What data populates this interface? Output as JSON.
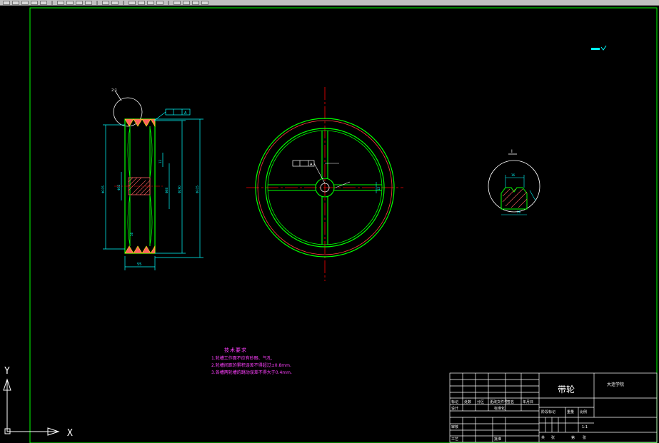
{
  "colors": {
    "background": "#000000",
    "frame": "#00ff00",
    "drawing": "#00ff00",
    "dimension": "#00ffff",
    "centerline": "#ff0000",
    "hatch": "#ff6060",
    "notes": "#ff40ff",
    "toolbar": "#c0c0c0"
  },
  "toolbar": {
    "icons": [
      "new-icon",
      "open-icon",
      "save-icon",
      "print-icon",
      "preview-icon",
      "cut-icon",
      "copy-icon",
      "paste-icon",
      "match-icon",
      "undo-icon",
      "redo-icon",
      "pan-icon",
      "zoom-icon",
      "zoom-window-icon",
      "zoom-previous-icon",
      "properties-icon",
      "design-center-icon",
      "tool-palette-icon",
      "help-icon"
    ]
  },
  "drawing": {
    "roughness_symbol": "▬",
    "section_view": {
      "detail_label": "2:1",
      "tolerance_frame": "A",
      "dim_width": "55",
      "dim_left_diameter": "Φ315",
      "dim_bore": "Φ32",
      "dim_hub": "Φ80",
      "dim_outer_1": "Φ290",
      "dim_outer_2": "Φ315",
      "dim_small_1": "12",
      "dim_small_2": "16"
    },
    "front_view": {
      "datum_frame": "A",
      "keyway_dim": "12"
    },
    "detail_view": {
      "label": "Ⅰ",
      "dim_groove": "16",
      "dim_depth": "26"
    },
    "technical_requirements": {
      "title": "技术要求",
      "items": [
        "1.轮槽工作面不应有砂眼、气孔.",
        "2.轮槽间距的累积误差不得超过±0.8mm.",
        "3.各槽两轮槽的跳动误差不得大于0.4mm."
      ]
    }
  },
  "title_block": {
    "part_name": "带轮",
    "school": "大连学院",
    "labels": {
      "mark": "标记",
      "count": "处数",
      "zone": "分区",
      "change_doc": "更改文件号",
      "signature": "签名",
      "date": "年月日",
      "designer": "设计",
      "standardize": "标准化",
      "stage_mark": "阶段标记",
      "weight": "重量",
      "scale": "比例",
      "review": "审核",
      "process": "工艺",
      "approve": "批准",
      "sheet_total": "共",
      "sheet_no": "第",
      "page_unit": "张"
    },
    "scale_value": "1:1"
  },
  "ucs": {
    "y_label": "Y",
    "x_label": "X"
  }
}
